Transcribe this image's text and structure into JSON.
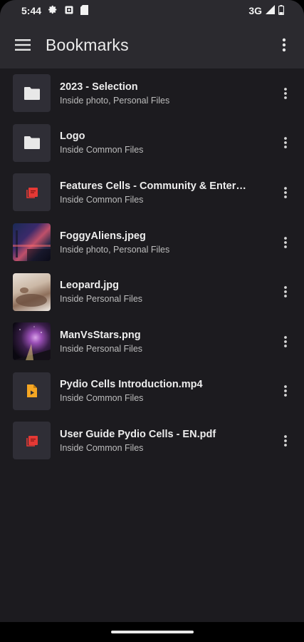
{
  "status_bar": {
    "time": "5:44",
    "network": "3G",
    "icons": [
      "settings-icon",
      "notification-icon",
      "sim-card-icon",
      "signal-icon",
      "battery-icon"
    ]
  },
  "app_bar": {
    "title": "Bookmarks",
    "menu_icon": "hamburger-menu-icon",
    "overflow_icon": "more-vert-icon"
  },
  "bookmarks": [
    {
      "title": "2023 - Selection",
      "subtitle": "Inside photo, Personal Files",
      "thumb": "folder-icon"
    },
    {
      "title": "Logo",
      "subtitle": "Inside Common Files",
      "thumb": "folder-icon"
    },
    {
      "title": "Features Cells - Community & Enter…",
      "subtitle": "Inside Common Files",
      "thumb": "pdf-icon"
    },
    {
      "title": "FoggyAliens.jpeg",
      "subtitle": "Inside photo, Personal Files",
      "thumb": "photo-foggy-aliens"
    },
    {
      "title": "Leopard.jpg",
      "subtitle": "Inside Personal Files",
      "thumb": "photo-leopard"
    },
    {
      "title": "ManVsStars.png",
      "subtitle": "Inside Personal Files",
      "thumb": "photo-man-vs-stars"
    },
    {
      "title": "Pydio Cells Introduction.mp4",
      "subtitle": "Inside Common Files",
      "thumb": "video-file-icon"
    },
    {
      "title": "User Guide Pydio Cells - EN.pdf",
      "subtitle": "Inside Common Files",
      "thumb": "pdf-icon"
    }
  ],
  "colors": {
    "background": "#1c1b1f",
    "app_bar": "#2b2a2f",
    "thumb_bg": "#2f2e36",
    "pdf_red": "#e53935",
    "video_orange": "#f5a623"
  }
}
